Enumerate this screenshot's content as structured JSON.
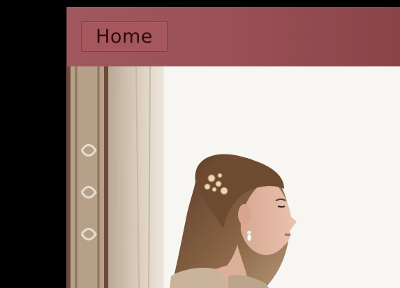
{
  "header": {
    "home_label": "Home",
    "background_color": "#9a5157"
  },
  "photo": {
    "alt": "",
    "background_color": "#f5f4f0"
  }
}
